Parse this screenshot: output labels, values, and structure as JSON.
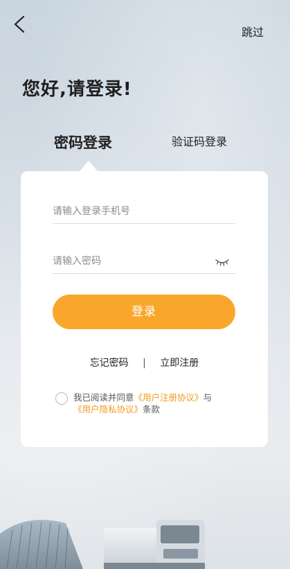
{
  "header": {
    "back_icon": "chevron-left-icon",
    "skip_label": "跳过"
  },
  "greeting": "您好,请登录!",
  "tabs": [
    {
      "label": "密码登录",
      "active": true
    },
    {
      "label": "验证码登录",
      "active": false
    }
  ],
  "form": {
    "phone_placeholder": "请输入登录手机号",
    "password_placeholder": "请输入密码",
    "eye_icon": "eye-closed-icon",
    "login_label": "登录"
  },
  "links": {
    "forgot_password": "忘记密码",
    "separator": "|",
    "register": "立即注册"
  },
  "agreement": {
    "prefix": "我已阅读并同意",
    "user_agreement": "《用户注册协议》",
    "conjunction": "与",
    "privacy_policy": "《用户隐私协议》",
    "suffix": "条款",
    "checked": false
  },
  "colors": {
    "accent": "#f9a72c",
    "link": "#f19a1f"
  }
}
